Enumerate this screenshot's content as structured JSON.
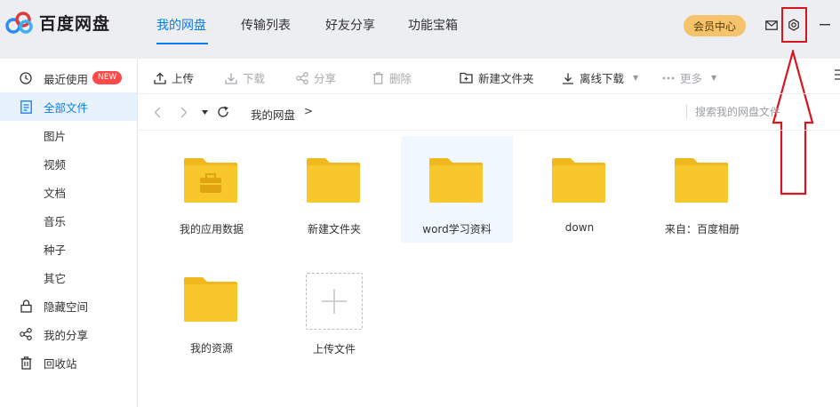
{
  "app": {
    "brand": "百度网盘"
  },
  "nav": {
    "tabs": [
      "我的网盘",
      "传输列表",
      "好友分享",
      "功能宝箱"
    ],
    "active": 0
  },
  "header": {
    "vip_label": "会员中心",
    "icons": [
      "mail-icon",
      "settings-icon",
      "minimize-icon"
    ]
  },
  "sidebar": {
    "items": [
      {
        "label": "最近使用",
        "icon": "clock-icon",
        "badge": "NEW"
      },
      {
        "label": "全部文件",
        "icon": "file-icon",
        "active": true
      },
      {
        "label": "图片",
        "sub": true
      },
      {
        "label": "视频",
        "sub": true
      },
      {
        "label": "文档",
        "sub": true
      },
      {
        "label": "音乐",
        "sub": true
      },
      {
        "label": "种子",
        "sub": true
      },
      {
        "label": "其它",
        "sub": true
      },
      {
        "label": "隐藏空间",
        "icon": "lock-icon"
      },
      {
        "label": "我的分享",
        "icon": "share-icon"
      },
      {
        "label": "回收站",
        "icon": "trash-icon"
      }
    ]
  },
  "toolbar": {
    "upload": "上传",
    "download": "下载",
    "share": "分享",
    "delete": "删除",
    "new_folder": "新建文件夹",
    "offline_download": "离线下载",
    "more": "更多"
  },
  "pathbar": {
    "crumb": "我的网盘",
    "separator": ">",
    "search_placeholder": "搜索我的网盘文件"
  },
  "files": [
    {
      "name": "我的应用数据",
      "type": "app-folder"
    },
    {
      "name": "新建文件夹",
      "type": "folder"
    },
    {
      "name": "word学习资料",
      "type": "folder",
      "hover": true
    },
    {
      "name": "down",
      "type": "folder"
    },
    {
      "name": "来自：百度相册",
      "type": "folder"
    },
    {
      "name": "我的资源",
      "type": "folder"
    }
  ],
  "upload_tile": {
    "label": "上传文件"
  },
  "colors": {
    "accent": "#0b7cf0",
    "folder": "#f8c72b",
    "folder_tab": "#f0b81d",
    "vip": "#f5c36b",
    "annotation": "#d8141c",
    "topbar_bg": "#eceef2"
  }
}
